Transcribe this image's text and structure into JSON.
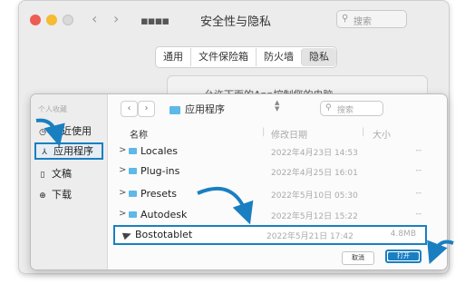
{
  "window": {
    "title": "安全性与隐私",
    "search_placeholder": "搜索",
    "nav_back": "‹",
    "nav_forward": "›",
    "grid_icon": "grid-icon"
  },
  "tabs": [
    {
      "label": "通用",
      "active": false
    },
    {
      "label": "文件保险箱",
      "active": false
    },
    {
      "label": "防火墙",
      "active": false
    },
    {
      "label": "隐私",
      "active": true
    }
  ],
  "background_panel_text": "允许下面的App控制您的电脑",
  "dialog": {
    "sidebar": {
      "heading": "个人收藏",
      "items": [
        {
          "label": "最近使用",
          "icon": "clock-icon",
          "selected": false
        },
        {
          "label": "应用程序",
          "icon": "apps-icon",
          "selected": true
        },
        {
          "label": "文稿",
          "icon": "document-icon",
          "selected": false
        },
        {
          "label": "下载",
          "icon": "download-icon",
          "selected": false
        }
      ]
    },
    "location": "应用程序",
    "search_placeholder": "搜索",
    "columns": {
      "name": "名称",
      "date": "修改日期",
      "size": "大小"
    },
    "files": [
      {
        "name": "Locales",
        "date": "2022年4月23日 14:53",
        "size": "--",
        "type": "folder"
      },
      {
        "name": "Plug-ins",
        "date": "2022年4月25日 16:01",
        "size": "--",
        "type": "folder"
      },
      {
        "name": "Presets",
        "date": "2022年5月10日 05:30",
        "size": "--",
        "type": "folder"
      },
      {
        "name": "Autodesk",
        "date": "2022年5月12日 15:22",
        "size": "--",
        "type": "folder"
      },
      {
        "name": "Bostotablet",
        "date": "2022年5月21日 17:42",
        "size": "4.8MB",
        "type": "app",
        "highlighted": true
      }
    ],
    "cancel_label": "取消",
    "open_label": "打开"
  },
  "colors": {
    "highlight": "#1a7fc1",
    "folder": "#5eb8e8",
    "traffic_red": "#ee5c54",
    "traffic_yellow": "#f5bb31"
  }
}
